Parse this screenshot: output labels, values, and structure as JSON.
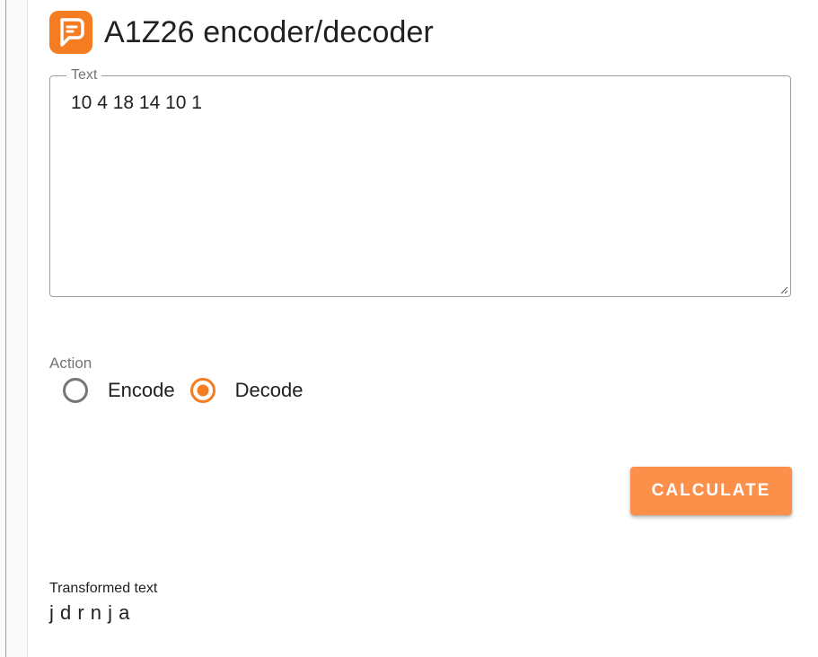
{
  "header": {
    "title": "A1Z26 encoder/decoder",
    "logo_icon": "planetcalc-logo-icon"
  },
  "colors": {
    "accent": "#f57c20",
    "button": "#fc8f49",
    "border": "#9e9e9e",
    "label": "#757575"
  },
  "text_field": {
    "label": "Text",
    "value": "10 4 18 14 10 1"
  },
  "action": {
    "label": "Action",
    "options": [
      {
        "label": "Encode",
        "selected": false
      },
      {
        "label": "Decode",
        "selected": true
      }
    ]
  },
  "calculate_button": {
    "label": "CALCULATE"
  },
  "result": {
    "label": "Transformed text",
    "value": "j d r n j a"
  }
}
